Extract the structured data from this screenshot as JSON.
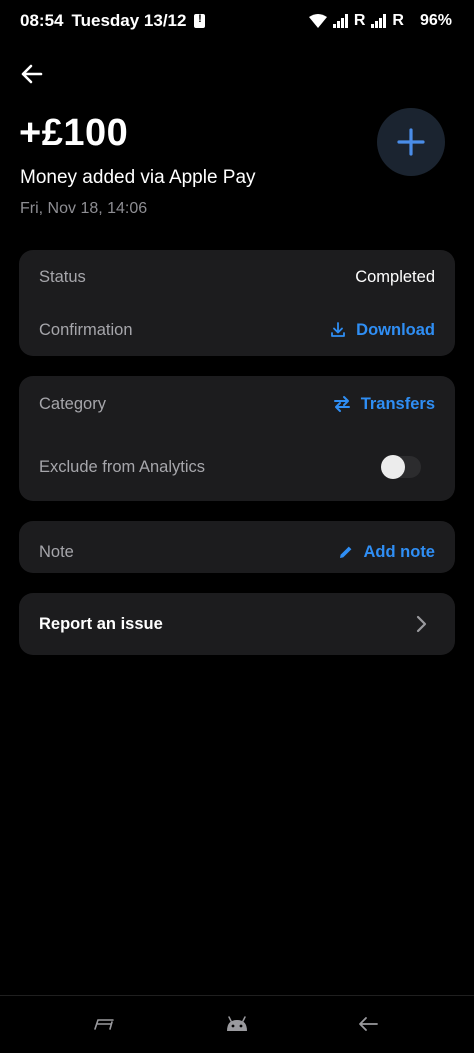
{
  "status_bar": {
    "time": "08:54",
    "date": "Tuesday 13/12",
    "roaming_1": "R",
    "roaming_2": "R",
    "battery": "96%"
  },
  "transaction": {
    "amount": "+£100",
    "description": "Money added via Apple Pay",
    "datetime": "Fri, Nov 18, 14:06"
  },
  "details": {
    "status_label": "Status",
    "status_value": "Completed",
    "confirmation_label": "Confirmation",
    "download_label": "Download"
  },
  "category": {
    "label": "Category",
    "value": "Transfers",
    "exclude_label": "Exclude from Analytics",
    "exclude_enabled": false
  },
  "note": {
    "label": "Note",
    "action": "Add note"
  },
  "report": {
    "label": "Report an issue"
  },
  "colors": {
    "accent": "#2f8ef4",
    "card": "#1c1c1e",
    "background": "#000000"
  }
}
